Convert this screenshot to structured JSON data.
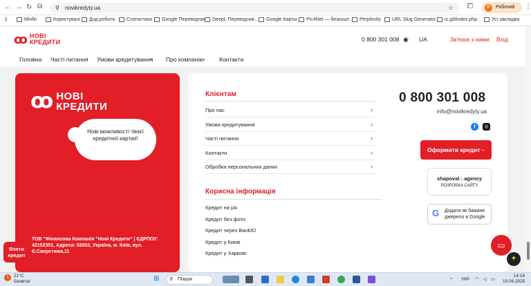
{
  "browser": {
    "url": "novikredyty.ua",
    "profile_name": "Робочий",
    "profile_initial": "P",
    "bookmarks": [
      "Minfin",
      "Користувачі",
      "Дод.робота",
      "Статистика",
      "Google Переводчик",
      "DeepL Переводчик...",
      "Google Карты",
      "Pic4Net — безкошт...",
      "Perplexity",
      "URL Slug Generator...",
      "is.gd/index.php"
    ],
    "all_bookmarks_label": "Усі закладки"
  },
  "header": {
    "logo_line1": "НОВІ",
    "logo_line2": "КРЕДИТИ",
    "phone": "0 800 301 008",
    "lang": "UA",
    "contact_us": "Зв'язок з нами",
    "login": "Вхід"
  },
  "nav": {
    "items": [
      "Головна",
      "Часті питання",
      "Умови кредитування",
      "Про компанію",
      "Контакти"
    ]
  },
  "redcard": {
    "logo_line1": "НОВІ",
    "logo_line2": "КРЕДИТИ",
    "cloud_text": "Нові можливості твоєї кредитної картки!",
    "address": "ТОВ \"Фінансова Компанія \"Нові Кредити\" | ЄДРПОУ: 42152351, Адреса: 02002, Україна, м. Київ, вул. Є.Сверстюка,11"
  },
  "take_credit": "Взяти кредит",
  "clients": {
    "title": "Клієнтам",
    "items": [
      "Про нас",
      "Умови кредитування",
      "Часті питання",
      "Контакти",
      "Обробка персональних даних"
    ]
  },
  "useful": {
    "title": "Корисна інформація",
    "items": [
      "Кредит на рік",
      "Кредит без фото",
      "Кредит через BankID",
      "Кредит у Києві",
      "Кредит у Харкові"
    ]
  },
  "contact": {
    "phone": "0 800 301 008",
    "email": "info@novikredyty.ua",
    "apply_label": "Оформити кредит",
    "shapoval_line1": "shapoval",
    "shapoval_line2": "agency",
    "shapoval_sub": "РОЗРОБКА САЙТУ",
    "google_badge": "Додати як бажане джерело в Google"
  },
  "taskbar": {
    "weather_temp": "21°C",
    "weather_desc": "Безвітрі",
    "search_placeholder": "Пошук",
    "lang": "УКР",
    "time": "14:18",
    "date": "10.09.2025"
  },
  "colors": {
    "brand_red": "#e21e26"
  }
}
